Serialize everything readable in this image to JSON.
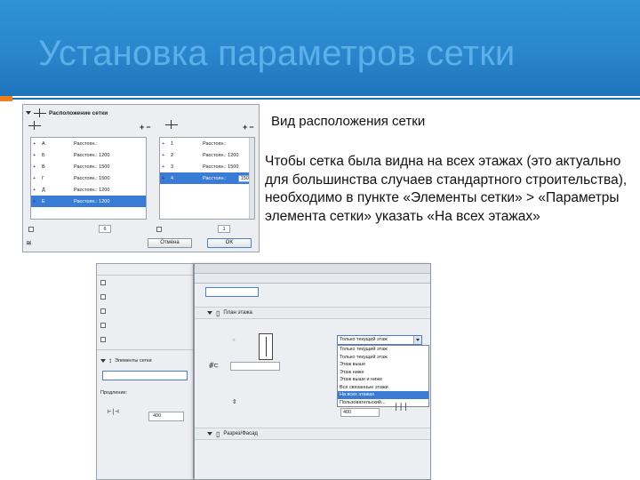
{
  "slide": {
    "title": "Установка параметров сетки",
    "caption": "Вид расположения сетки",
    "body": "Чтобы сетка была видна на всех этажах (это актуально для большинства случаев стандартного строительства), необходимо в пункте «Элементы сетки» > «Параметры элемента сетки» указать «На всех этажах»",
    "colors": {
      "title_band": "#2a86cc",
      "accent": "#ef7f1a",
      "rule": "#1f6fb5"
    }
  },
  "grid_dialog": {
    "header": "Расположение сетки",
    "left_list": [
      {
        "name": "А",
        "dist": "Расстоян.:"
      },
      {
        "name": "Б",
        "dist": "Расстоян.: 1200"
      },
      {
        "name": "В",
        "dist": "Расстоян.: 1500"
      },
      {
        "name": "Г",
        "dist": "Расстоян.: 1500"
      },
      {
        "name": "Д",
        "dist": "Расстоян.: 1200"
      },
      {
        "name": "Е",
        "dist": "Расстоян.: 1200"
      }
    ],
    "left_selected": 5,
    "right_list": [
      {
        "name": "1",
        "dist": "Расстоян.:"
      },
      {
        "name": "2",
        "dist": "Расстоян.: 1200"
      },
      {
        "name": "3",
        "dist": "Расстоян.: 1500"
      },
      {
        "name": "4",
        "dist": "Расстоян.:"
      }
    ],
    "right_selected": 3,
    "right_edit_value": "1500",
    "left_count": "6",
    "right_count": "1",
    "ok_label": "OK",
    "cancel_label": "Отмена"
  },
  "grid_props_back": {
    "row1": "Элементы сетки",
    "field_label": "Продление:",
    "value": "400"
  },
  "grid_props_front": {
    "section_plan": "План этажа",
    "selected_option": "Только текущий этаж",
    "options": [
      "Только текущий этаж",
      "Только текущий этаж",
      "Этаж выше",
      "Этаж ниже",
      "Этаж выше и ниже",
      "Все связанные этажи",
      "На всех этажах",
      "Пользовательский..."
    ],
    "highlighted_index": 6,
    "value": "400",
    "section_section": "Разрез/Фасад"
  }
}
